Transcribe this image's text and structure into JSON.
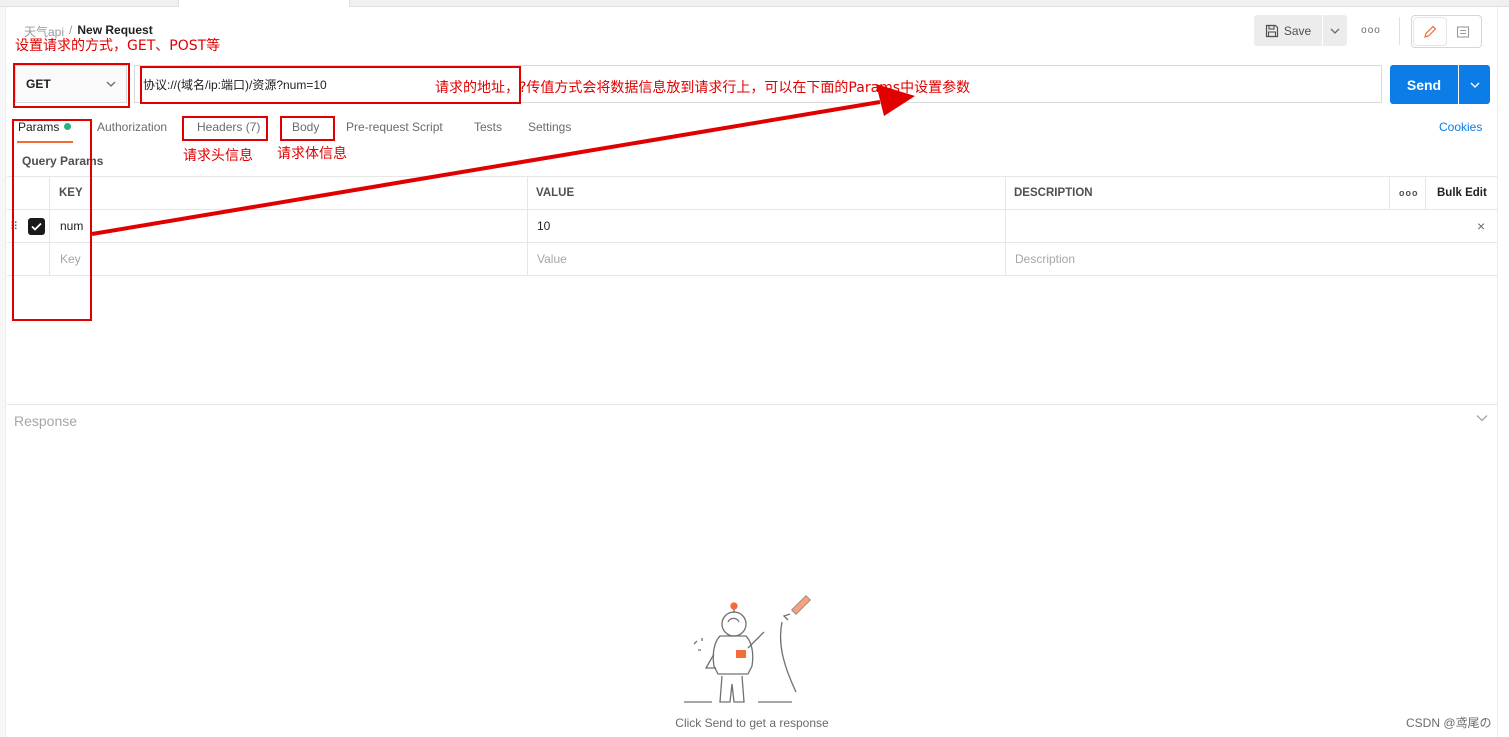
{
  "breadcrumb": {
    "collection": "天气api",
    "separator": "/",
    "current": "New Request"
  },
  "header": {
    "save_label": "Save",
    "more_label": "ooo"
  },
  "request": {
    "method": "GET",
    "url": "协议://(域名/ip:端口)/资源?num=10",
    "send_label": "Send"
  },
  "tabs": {
    "params": "Params",
    "authorization": "Authorization",
    "headers": "Headers (7)",
    "body": "Body",
    "pre_request": "Pre-request Script",
    "tests": "Tests",
    "settings": "Settings",
    "cookies": "Cookies"
  },
  "params": {
    "section_title": "Query Params",
    "columns": {
      "key": "KEY",
      "value": "VALUE",
      "description": "DESCRIPTION",
      "more": "ooo",
      "bulk_edit": "Bulk Edit"
    },
    "rows": [
      {
        "key": "num",
        "value": "10",
        "description": "",
        "checked": true
      }
    ],
    "placeholders": {
      "key": "Key",
      "value": "Value",
      "description": "Description"
    }
  },
  "response": {
    "title": "Response",
    "empty_message": "Click Send to get a response"
  },
  "annotations": {
    "method_note": "设置请求的方式，GET、POST等",
    "url_note": "请求的地址，?传值方式会将数据信息放到请求行上，可以在下面的Params中设置参数",
    "headers_note": "请求头信息",
    "body_note": "请求体信息"
  },
  "watermark": "CSDN @鸢尾の",
  "colors": {
    "accent": "#0c7ce6",
    "tab_underline": "#f26b3a",
    "status_dot": "#26b47f",
    "annotation": "#e00000"
  }
}
